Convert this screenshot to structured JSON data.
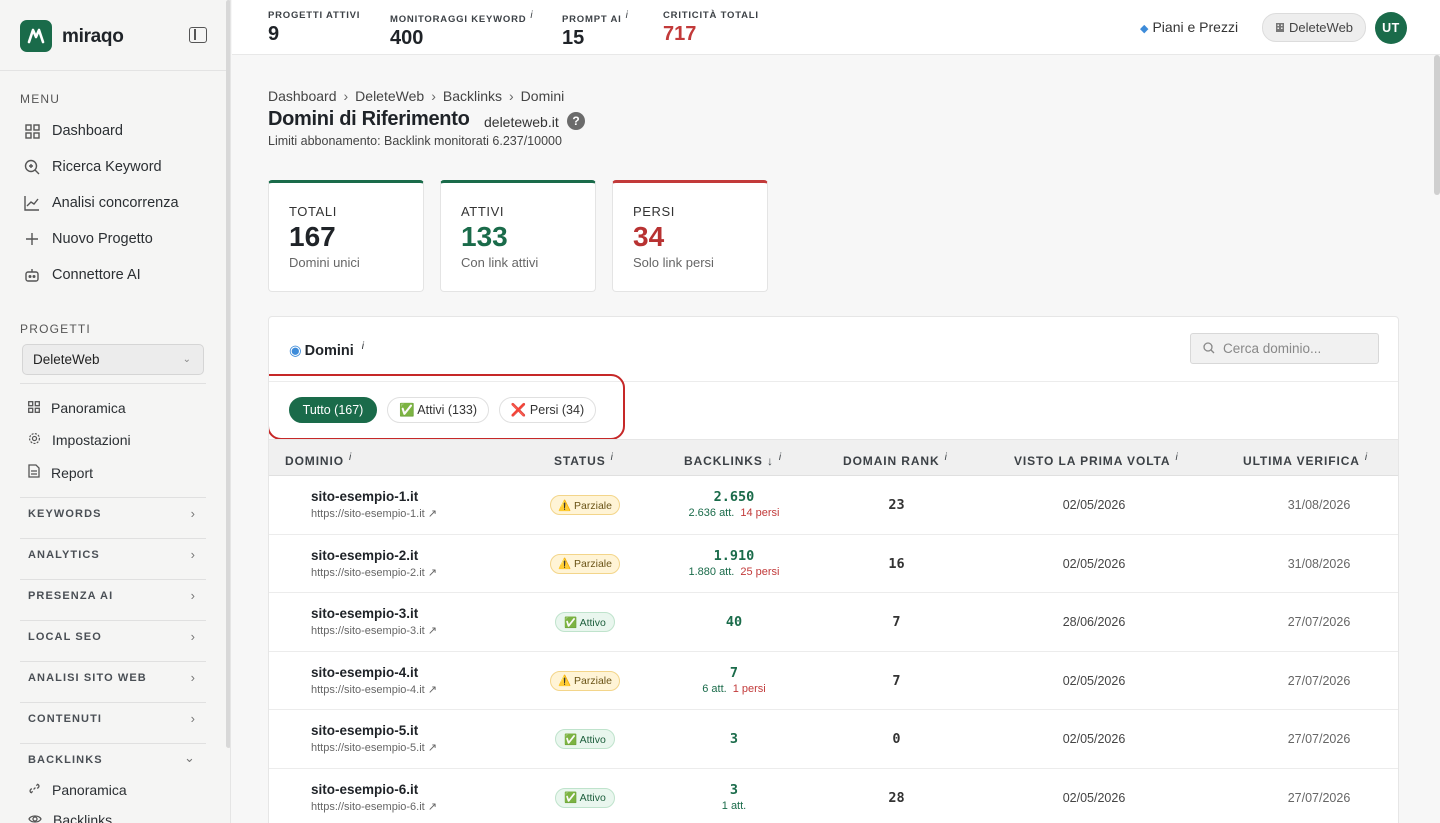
{
  "app": {
    "logo_text": "miraqo"
  },
  "sidebar": {
    "menu_title": "MENU",
    "menu": [
      {
        "label": "Dashboard",
        "icon": "grid-icon"
      },
      {
        "label": "Ricerca Keyword",
        "icon": "search-plus-icon"
      },
      {
        "label": "Analisi concorrenza",
        "icon": "chart-line-icon"
      },
      {
        "label": "Nuovo Progetto",
        "icon": "plus-icon"
      },
      {
        "label": "Connettore AI",
        "icon": "robot-icon"
      }
    ],
    "projects_title": "PROGETTI",
    "project_selected": "DeleteWeb",
    "project_items": [
      {
        "label": "Panoramica",
        "icon": "grid-icon"
      },
      {
        "label": "Impostazioni",
        "icon": "gear-icon"
      },
      {
        "label": "Report",
        "icon": "document-icon"
      }
    ],
    "groups": [
      "KEYWORDS",
      "ANALYTICS",
      "PRESENZA AI",
      "LOCAL SEO",
      "ANALISI SITO WEB",
      "CONTENUTI"
    ],
    "backlinks_group": "BACKLINKS",
    "backlinks_items": [
      {
        "label": "Panoramica",
        "icon": "link-icon"
      },
      {
        "label": "Backlinks",
        "icon": "eye-icon"
      }
    ]
  },
  "topbar": {
    "stats": [
      {
        "label": "PROGETTI ATTIVI",
        "value": "9",
        "info": ""
      },
      {
        "label": "MONITORAGGI KEYWORD",
        "value": "400",
        "info": "i"
      },
      {
        "label": "PROMPT AI",
        "value": "15",
        "info": "i"
      },
      {
        "label": "CRITICITÀ TOTALI",
        "value": "717",
        "info": ""
      }
    ],
    "plans_label": "Piani e Prezzi",
    "project_pill": "DeleteWeb",
    "avatar": "UT",
    "accent_color": "#1a6b4a",
    "danger_color": "#c23a3a"
  },
  "header": {
    "breadcrumb": [
      "Dashboard",
      "DeleteWeb",
      "Backlinks",
      "Domini"
    ],
    "title": "Domini di Riferimento",
    "domain": "deleteweb.it",
    "help": "?",
    "limits": "Limiti abbonamento: Backlink monitorati 6.237/10000"
  },
  "kpis": [
    {
      "label": "TOTALI",
      "value": "167",
      "sub": "Domini unici"
    },
    {
      "label": "ATTIVI",
      "value": "133",
      "sub": "Con link attivi"
    },
    {
      "label": "PERSI",
      "value": "34",
      "sub": "Solo link persi"
    }
  ],
  "panel": {
    "title": "Domini",
    "title_info": "i",
    "search_placeholder": "Cerca dominio...",
    "filters": [
      {
        "label": "Tutto (167)",
        "active": true
      },
      {
        "label": "✅ Attivi (133)",
        "active": false
      },
      {
        "label": "❌ Persi (34)",
        "active": false
      }
    ],
    "columns": [
      {
        "label": "DOMINIO",
        "info": "i"
      },
      {
        "label": "STATUS",
        "info": "i"
      },
      {
        "label": "BACKLINKS ↓",
        "info": "i"
      },
      {
        "label": "DOMAIN RANK",
        "info": "i"
      },
      {
        "label": "VISTO LA PRIMA VOLTA",
        "info": "i"
      },
      {
        "label": "ULTIMA VERIFICA",
        "info": "i"
      }
    ],
    "rows": [
      {
        "domain": "sito-esempio-1.it",
        "url": "https://sito-esempio-1.it ↗",
        "status": "⚠️ Parziale",
        "backlinks": "2.650",
        "active": "2.636 att.",
        "lost": "14 persi",
        "rank": "23",
        "first_seen": "02/05/2026",
        "last_check": "31/08/2026"
      },
      {
        "domain": "sito-esempio-2.it",
        "url": "https://sito-esempio-2.it ↗",
        "status": "⚠️ Parziale",
        "backlinks": "1.910",
        "active": "1.880 att.",
        "lost": "25 persi",
        "rank": "16",
        "first_seen": "02/05/2026",
        "last_check": "31/08/2026"
      },
      {
        "domain": "sito-esempio-3.it",
        "url": "https://sito-esempio-3.it ↗",
        "status": "✅ Attivo",
        "backlinks": "40",
        "active": "",
        "lost": "",
        "rank": "7",
        "first_seen": "28/06/2026",
        "last_check": "27/07/2026"
      },
      {
        "domain": "sito-esempio-4.it",
        "url": "https://sito-esempio-4.it ↗",
        "status": "⚠️ Parziale",
        "backlinks": "7",
        "active": "6 att.",
        "lost": "1 persi",
        "rank": "7",
        "first_seen": "02/05/2026",
        "last_check": "27/07/2026"
      },
      {
        "domain": "sito-esempio-5.it",
        "url": "https://sito-esempio-5.it ↗",
        "status": "✅ Attivo",
        "backlinks": "3",
        "active": "",
        "lost": "",
        "rank": "0",
        "first_seen": "02/05/2026",
        "last_check": "27/07/2026"
      },
      {
        "domain": "sito-esempio-6.it",
        "url": "https://sito-esempio-6.it ↗",
        "status": "✅ Attivo",
        "backlinks": "3",
        "active": "1 att.",
        "lost": "",
        "rank": "28",
        "first_seen": "02/05/2026",
        "last_check": "27/07/2026"
      }
    ]
  }
}
